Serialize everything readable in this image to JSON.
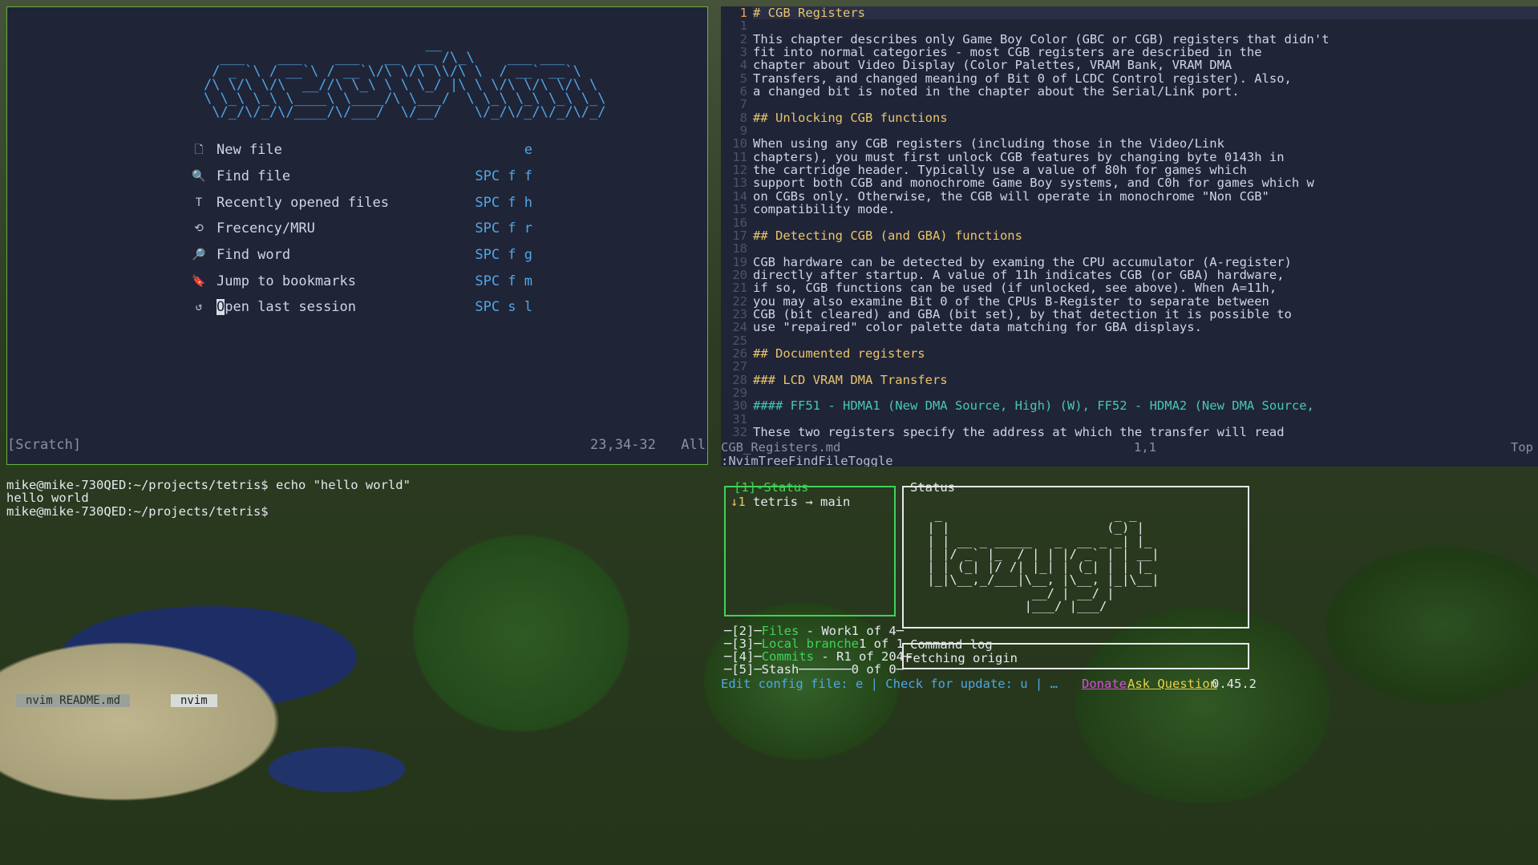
{
  "left_pane": {
    "ascii_logo": "                           __\n  ___    ___    ___   __  __ /\\_\\    ___ ___\n / _ `\\ / __`\\ / __`\\/\\ \\/\\ \\\\/\\ \\  / __` __`\\\n/\\ \\/\\ \\/\\  __//\\ \\_\\ \\ \\ \\_/ |\\ \\ \\/\\ \\/\\ \\/\\ \\\n\\ \\_\\ \\_\\ \\____\\ \\____/\\ \\___/  \\ \\_\\ \\_\\ \\_\\ \\_\\\n \\/_/\\/_/\\/____/\\/___/  \\/__/    \\/_/\\/_/\\/_/\\/_/",
    "menu": [
      {
        "icon": "file-icon",
        "glyph": "🗋",
        "label": "New file",
        "key": "e"
      },
      {
        "icon": "find-file-icon",
        "glyph": "🔍",
        "label": "Find file",
        "key": "SPC f f"
      },
      {
        "icon": "text-icon",
        "glyph": "T",
        "label": "Recently opened files",
        "key": "SPC f h"
      },
      {
        "icon": "history-icon",
        "glyph": "⟲",
        "label": "Frecency/MRU",
        "key": "SPC f r"
      },
      {
        "icon": "find-word-icon",
        "glyph": "🔎",
        "label": "Find word",
        "key": "SPC f g"
      },
      {
        "icon": "bookmark-icon",
        "glyph": "🔖",
        "label": "Jump to bookmarks",
        "key": "SPC f m"
      },
      {
        "icon": "restore-icon",
        "glyph": "↺",
        "label": "Open last session",
        "key": "SPC s l"
      }
    ],
    "status": {
      "name": "[Scratch]",
      "position": "23,34-32",
      "scroll": "All"
    }
  },
  "right_pane": {
    "lines": [
      {
        "n": "1",
        "text": "# CGB Registers",
        "style": "h1",
        "current": true
      },
      {
        "n": "1",
        "text": "",
        "style": ""
      },
      {
        "n": "2",
        "text": "This chapter describes only Game Boy Color (GBC or CGB) registers that didn't",
        "style": ""
      },
      {
        "n": "3",
        "text": "fit into normal categories - most CGB registers are described in the",
        "style": ""
      },
      {
        "n": "4",
        "text": "chapter about Video Display (Color Palettes, VRAM Bank, VRAM DMA",
        "style": ""
      },
      {
        "n": "5",
        "text": "Transfers, and changed meaning of Bit 0 of LCDC Control register). Also,",
        "style": ""
      },
      {
        "n": "6",
        "text": "a changed bit is noted in the chapter about the Serial/Link port.",
        "style": ""
      },
      {
        "n": "7",
        "text": "",
        "style": ""
      },
      {
        "n": "8",
        "text": "## Unlocking CGB functions",
        "style": "h2"
      },
      {
        "n": "9",
        "text": "",
        "style": ""
      },
      {
        "n": "10",
        "text": "When using any CGB registers (including those in the Video/Link",
        "style": ""
      },
      {
        "n": "11",
        "text": "chapters), you must first unlock CGB features by changing byte 0143h in",
        "style": ""
      },
      {
        "n": "12",
        "text": "the cartridge header. Typically use a value of 80h for games which",
        "style": ""
      },
      {
        "n": "13",
        "text": "support both CGB and monochrome Game Boy systems, and C0h for games which w",
        "style": ""
      },
      {
        "n": "14",
        "text": "on CGBs only. Otherwise, the CGB will operate in monochrome \"Non CGB\"",
        "style": ""
      },
      {
        "n": "15",
        "text": "compatibility mode.",
        "style": ""
      },
      {
        "n": "16",
        "text": "",
        "style": ""
      },
      {
        "n": "17",
        "text": "## Detecting CGB (and GBA) functions",
        "style": "h2"
      },
      {
        "n": "18",
        "text": "",
        "style": ""
      },
      {
        "n": "19",
        "text": "CGB hardware can be detected by examing the CPU accumulator (A-register)",
        "style": ""
      },
      {
        "n": "20",
        "text": "directly after startup. A value of 11h indicates CGB (or GBA) hardware,",
        "style": ""
      },
      {
        "n": "21",
        "text": "if so, CGB functions can be used (if unlocked, see above). When A=11h,",
        "style": ""
      },
      {
        "n": "22",
        "text": "you may also examine Bit 0 of the CPUs B-Register to separate between",
        "style": ""
      },
      {
        "n": "23",
        "text": "CGB (bit cleared) and GBA (bit set), by that detection it is possible to",
        "style": ""
      },
      {
        "n": "24",
        "text": "use \"repaired\" color palette data matching for GBA displays.",
        "style": ""
      },
      {
        "n": "25",
        "text": "",
        "style": ""
      },
      {
        "n": "26",
        "text": "## Documented registers",
        "style": "h2"
      },
      {
        "n": "27",
        "text": "",
        "style": ""
      },
      {
        "n": "28",
        "text": "### LCD VRAM DMA Transfers",
        "style": "h3"
      },
      {
        "n": "29",
        "text": "",
        "style": ""
      },
      {
        "n": "30",
        "text": "#### FF51 - HDMA1 (New DMA Source, High) (W), FF52 - HDMA2 (New DMA Source,",
        "style": "h4"
      },
      {
        "n": "31",
        "text": "",
        "style": ""
      },
      {
        "n": "32",
        "text": "These two registers specify the address at which the transfer will read",
        "style": ""
      }
    ],
    "status": {
      "name": "CGB_Registers.md",
      "position": "1,1",
      "scroll": "Top"
    },
    "cmdline": ":NvimTreeFindFileToggle"
  },
  "terminal": {
    "lines": [
      "mike@mike-730QED:~/projects/tetris$ echo \"hello world\"",
      "hello world",
      "mike@mike-730QED:~/projects/tetris$"
    ]
  },
  "lazygit": {
    "status_title": "[1]-Status",
    "status_arrow": "↓1",
    "status_text": " tetris → main",
    "files_row": {
      "prefix": "─[2]─",
      "label": "Files",
      "rest": " - Work",
      "count": "1 of 4─"
    },
    "branches_row": {
      "prefix": "─[3]─",
      "label": "Local branche",
      "count": "1 of 1─"
    },
    "commits_row": {
      "prefix": "─[4]─",
      "label": "Commits",
      "rest": " - R",
      "count": "1 of 204─"
    },
    "stash_row": {
      "prefix": "─[5]─",
      "label": "Stash",
      "rest": "───────",
      "count": "0 of 0─"
    },
    "main_title": "Status",
    "logo": "  _                       _ _\n | |                     (_) |\n | | __ _ _____   _  __ _ _| |_\n | |/ _` |_  / | | |/ _` | | __|\n | | (_| |/ /| |_| | (_| | | |_\n |_|\\__,_/___|\\__, |\\__, |_|\\__|\n               __/ | __/ |\n              |___/ |___/",
    "cmd_title": "Command log",
    "cmd_text": "Fetching origin",
    "hint": "Edit config file: e | Check for update: u | …",
    "donate": "Donate",
    "ask": "Ask Question",
    "version": "0.45.2"
  },
  "tmux": {
    "tab1": "nvim README.md",
    "tab2": "nvim"
  }
}
